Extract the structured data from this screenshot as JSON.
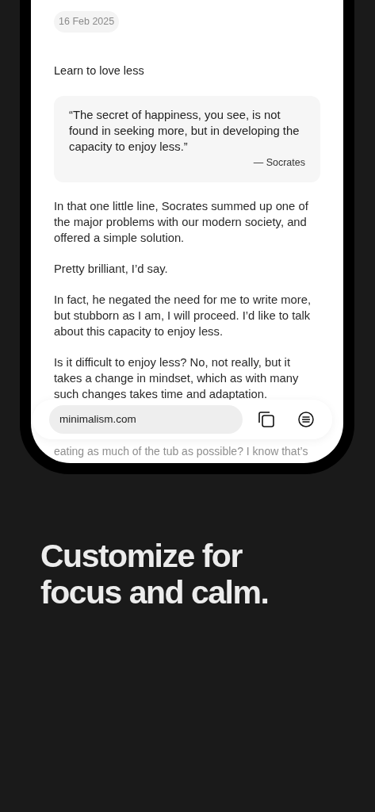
{
  "article": {
    "date": "16 Feb 2025",
    "title": "Learn to love less",
    "quote": {
      "text": "“The secret of happiness, you see, is not found in seeking more, but in developing the capacity to enjoy less.”",
      "author": "— Socrates"
    },
    "paragraphs": [
      "In that one little line, Socrates summed up one of the major problems with our modern society, and offered a simple solution.",
      "Pretty brilliant, I’d say.",
      "In fact, he negated the need for me to write more, but stubborn as I am, I will proceed. I’d like to talk about this capacity to enjoy less.",
      "Is it difficult to enjoy less? No, not really, but it takes a change in mindset, which as with many such changes takes time and adaptation."
    ],
    "faded_line": "eating as much of the tub as possible? I know that’s"
  },
  "address_bar": {
    "url": "minimalism.com"
  },
  "headline": "Customize for focus and calm."
}
